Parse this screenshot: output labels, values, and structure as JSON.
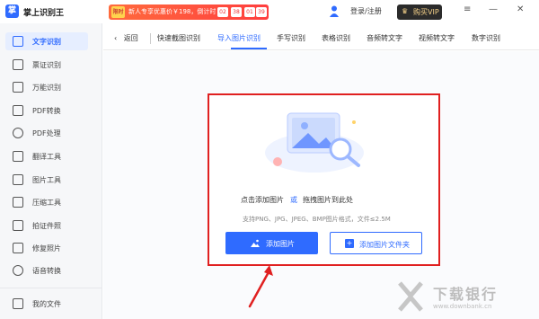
{
  "app": {
    "logo_char": "掌",
    "name": "掌上识别王"
  },
  "promo": {
    "badge": "限时",
    "text": "新人专享优惠价￥198，倒计时",
    "countdown": [
      "02",
      "38",
      "01",
      "39"
    ]
  },
  "header": {
    "login_label": "登录/注册",
    "vip_label": "购买VIP",
    "vip_icon": "♛",
    "window_controls": [
      "≡",
      "—",
      "✕"
    ]
  },
  "sidebar": {
    "items": [
      {
        "label": "文字识别",
        "active": true,
        "icon": "text-recognition-icon"
      },
      {
        "label": "票证识别",
        "icon": "ticket-icon"
      },
      {
        "label": "万能识别",
        "icon": "universal-scan-icon"
      },
      {
        "label": "PDF转换",
        "icon": "pdf-convert-icon"
      },
      {
        "label": "PDF处理",
        "icon": "pdf-process-icon"
      },
      {
        "label": "翻译工具",
        "icon": "translate-icon"
      },
      {
        "label": "图片工具",
        "icon": "image-tool-icon"
      },
      {
        "label": "压缩工具",
        "icon": "compress-icon"
      },
      {
        "label": "拍证件照",
        "icon": "id-photo-icon"
      },
      {
        "label": "修复照片",
        "icon": "repair-photo-icon"
      },
      {
        "label": "语音转换",
        "icon": "voice-convert-icon"
      }
    ],
    "footer_label": "我的文件"
  },
  "tabs": {
    "back_label": "返回",
    "items": [
      {
        "label": "快速截图识别"
      },
      {
        "label": "导入图片识别",
        "active": true
      },
      {
        "label": "手写识别"
      },
      {
        "label": "表格识别"
      },
      {
        "label": "音频转文字"
      },
      {
        "label": "视频转文字"
      },
      {
        "label": "数字识别"
      }
    ]
  },
  "dropzone": {
    "title_part1": "点击添加图片",
    "title_or": "或",
    "title_part2": "拖拽图片到此处",
    "subtitle": "支持PNG、JPG、JPEG、BMP图片格式，文件≤2.5M",
    "add_image_label": "添加图片",
    "add_folder_label": "添加图片文件夹"
  },
  "watermark": {
    "text": "下载银行",
    "url": "www.downbank.cn"
  },
  "colors": {
    "accent": "#2f6bff",
    "highlight": "#e02020",
    "promo": "#ff4a3a"
  }
}
